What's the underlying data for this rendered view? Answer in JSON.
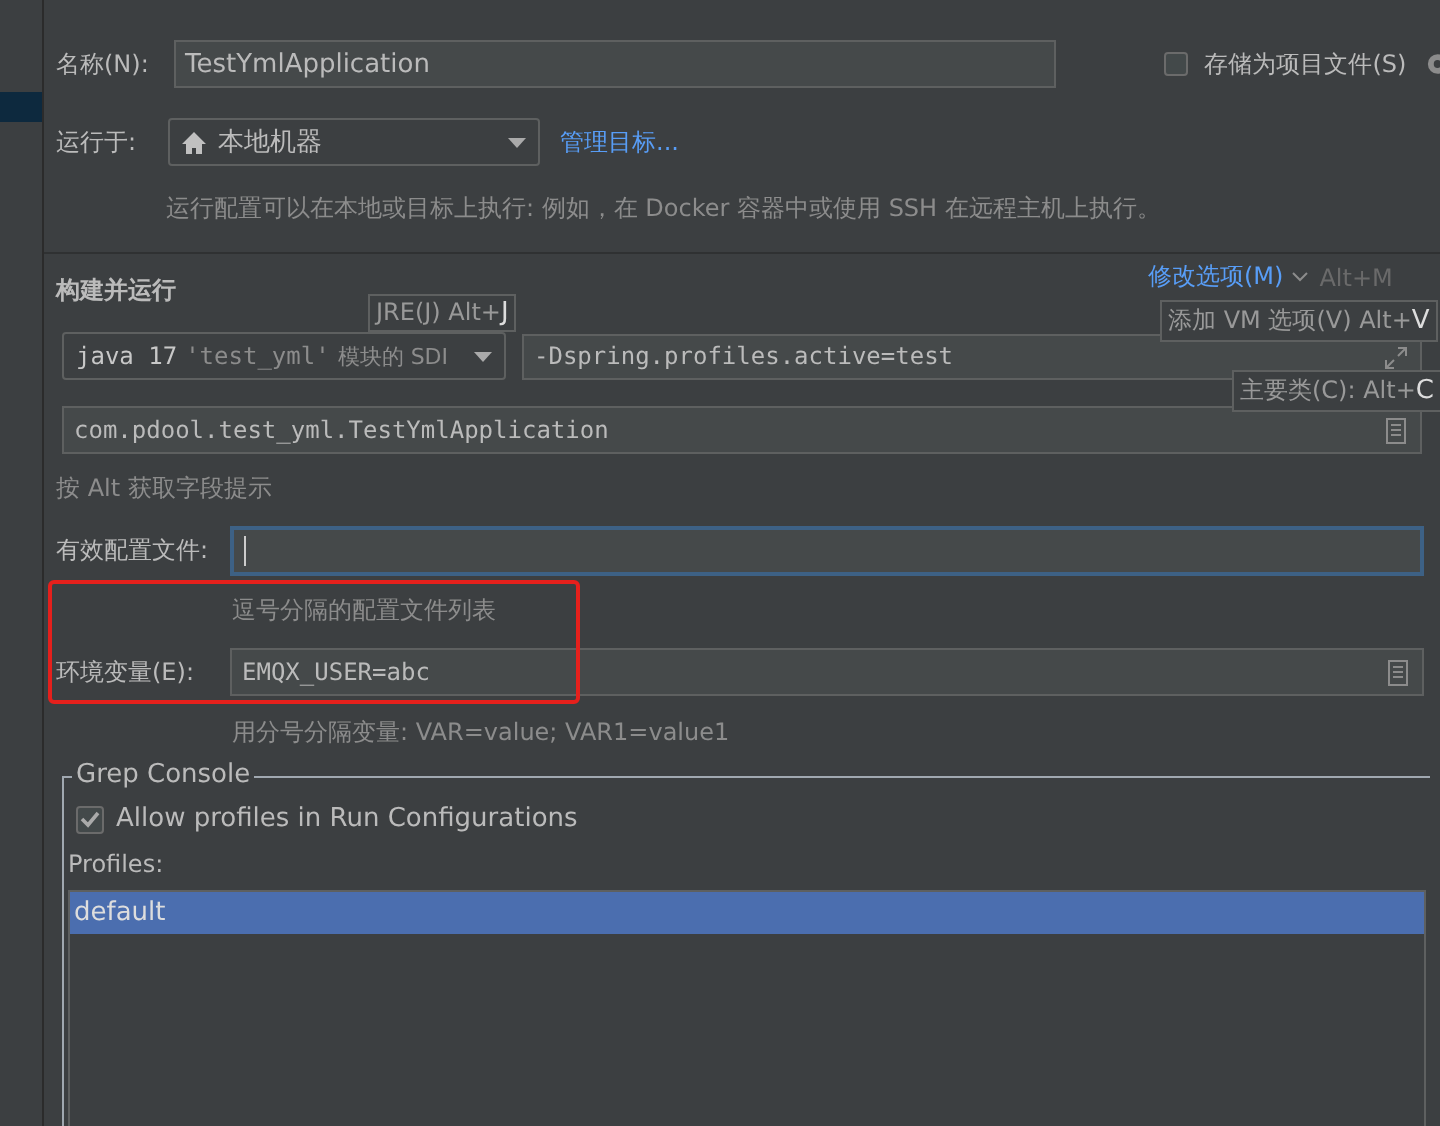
{
  "name_row": {
    "label": "名称(N):",
    "value": "TestYmlApplication",
    "store_checkbox": {
      "label": "存储为项目文件(S)",
      "checked": false
    }
  },
  "run_on": {
    "label": "运行于:",
    "value": "本地机器",
    "link": "管理目标...",
    "hint": "运行配置可以在本地或目标上执行: 例如，在 Docker 容器中或使用 SSH 在远程主机上执行。"
  },
  "build_run": {
    "title": "构建并运行",
    "modify_options": "修改选项(M)",
    "modify_shortcut": "Alt+M",
    "jdk_dropdown": {
      "mono": "java 17",
      "module": "'test_yml'",
      "suffix": "模块的 SDI"
    },
    "vm_options": "-Dspring.profiles.active=test",
    "main_class": "com.pdool.test_yml.TestYmlApplication",
    "field_hint": "按 Alt 获取字段提示",
    "tooltips": [
      {
        "text": "JRE(J) Alt+",
        "key": "J"
      },
      {
        "text": "添加 VM 选项(V) Alt+",
        "key": "V"
      },
      {
        "text": "主要类(C): Alt+",
        "key": "C"
      }
    ]
  },
  "active_profiles": {
    "label": "有效配置文件:",
    "hint": "逗号分隔的配置文件列表"
  },
  "env_vars": {
    "label": "环境变量(E):",
    "value": "EMQX_USER=abc",
    "hint": "用分号分隔变量: VAR=value; VAR1=value1"
  },
  "grep_console": {
    "title": "Grep Console",
    "allow_profiles": {
      "label": "Allow profiles in Run Configurations",
      "checked": true
    },
    "profiles_label": "Profiles:",
    "profiles": [
      {
        "name": "default",
        "selected": true
      }
    ]
  }
}
